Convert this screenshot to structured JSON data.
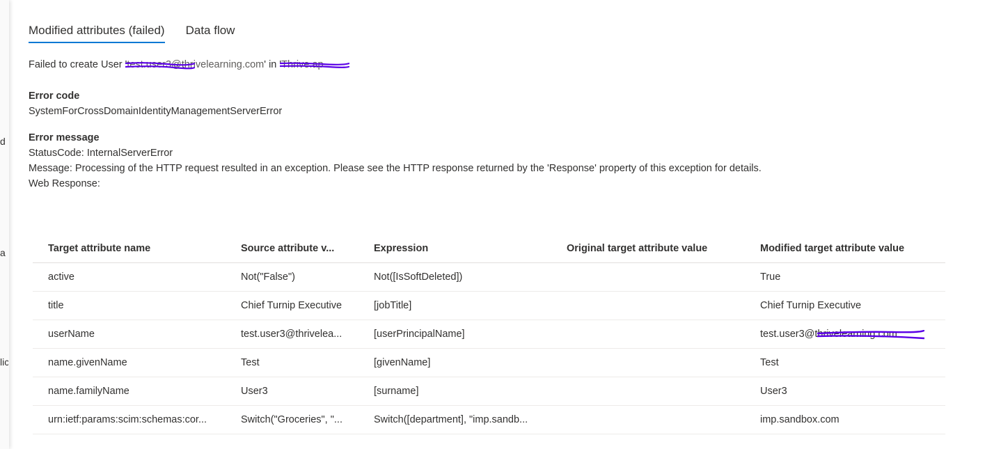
{
  "left_fragments": [
    "d",
    "a",
    "lic"
  ],
  "tabs": [
    {
      "label": "Modified attributes (failed)",
      "active": true
    },
    {
      "label": "Data flow",
      "active": false
    }
  ],
  "status": {
    "prefix": "Failed to create User '",
    "user_redacted": "test.user3@thrivelearning.com",
    "middle": "' in '",
    "tenant_redacted": "Thrive.ap"
  },
  "error_code": {
    "heading": "Error code",
    "value": "SystemForCrossDomainIdentityManagementServerError"
  },
  "error_message": {
    "heading": "Error message",
    "lines": [
      "StatusCode: InternalServerError",
      "Message: Processing of the HTTP request resulted in an exception. Please see the HTTP response returned by the 'Response' property of this exception for details.",
      "Web Response:"
    ]
  },
  "table": {
    "columns": [
      "Target attribute name",
      "Source attribute v...",
      "Expression",
      "Original target attribute value",
      "Modified target attribute value"
    ],
    "rows": [
      [
        "active",
        "Not(\"False\")",
        "Not([IsSoftDeleted])",
        "",
        "True"
      ],
      [
        "title",
        "Chief Turnip Executive",
        "[jobTitle]",
        "",
        "Chief Turnip Executive"
      ],
      [
        "userName",
        "test.user3@thrivelea...",
        "[userPrincipalName]",
        "",
        "test.user3@thrivelearning.com"
      ],
      [
        "name.givenName",
        "Test",
        "[givenName]",
        "",
        "Test"
      ],
      [
        "name.familyName",
        "User3",
        "[surname]",
        "",
        "User3"
      ],
      [
        "urn:ietf:params:scim:schemas:cor...",
        "Switch(\"Groceries\", \"...",
        "Switch([department], \"imp.sandb...",
        "",
        "imp.sandbox.com"
      ]
    ]
  },
  "colors": {
    "accent": "#0078d4",
    "redaction": "#5a00e6"
  }
}
